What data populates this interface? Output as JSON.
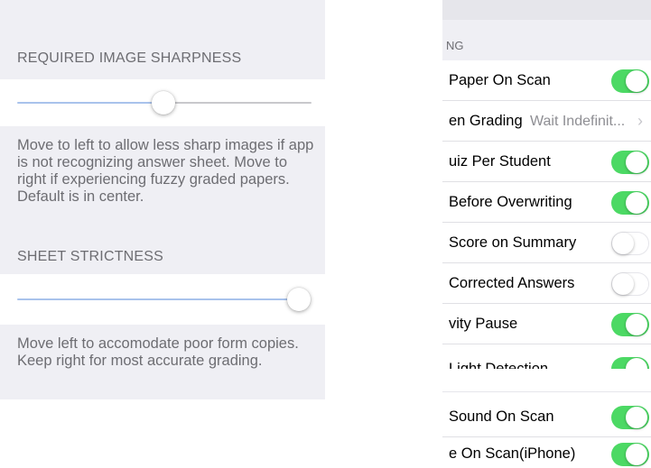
{
  "left": {
    "sharpness": {
      "header": "REQUIRED IMAGE SHARPNESS",
      "slider_value": 0.5,
      "note": "Move to left to allow less sharp images if app is not recognizing answer sheet. Move to right if experiencing fuzzy graded papers.  Default is in center."
    },
    "strictness": {
      "header": "SHEET STRICTNESS",
      "slider_value": 1.0,
      "note": "Move left to accomodate poor form copies.  Keep right for most accurate grading."
    }
  },
  "right": {
    "group_header": "NG",
    "rows": [
      {
        "label": "Paper On Scan",
        "toggle": "on"
      },
      {
        "label": "en Grading",
        "value": "Wait Indefinit...",
        "chevron": "›"
      },
      {
        "label": "uiz Per Student",
        "toggle": "on"
      },
      {
        "label": "Before Overwriting",
        "toggle": "on"
      },
      {
        "label": "Score on Summary",
        "toggle": "off"
      },
      {
        "label": "Corrected Answers",
        "toggle": "off"
      },
      {
        "label": "vity Pause",
        "toggle": "on"
      },
      {
        "label": "Light Detection",
        "toggle": "on"
      }
    ],
    "rows2": [
      {
        "label": "Sound On Scan",
        "toggle": "on"
      },
      {
        "label": "e On Scan(iPhone)",
        "toggle": "on"
      }
    ]
  },
  "colors": {
    "accent": "#4cd964",
    "slider_fill": "#a9c3ec",
    "slider_track": "#c8c8cc",
    "group_bg": "#efeff4",
    "secondary_text": "#6d6d72"
  }
}
